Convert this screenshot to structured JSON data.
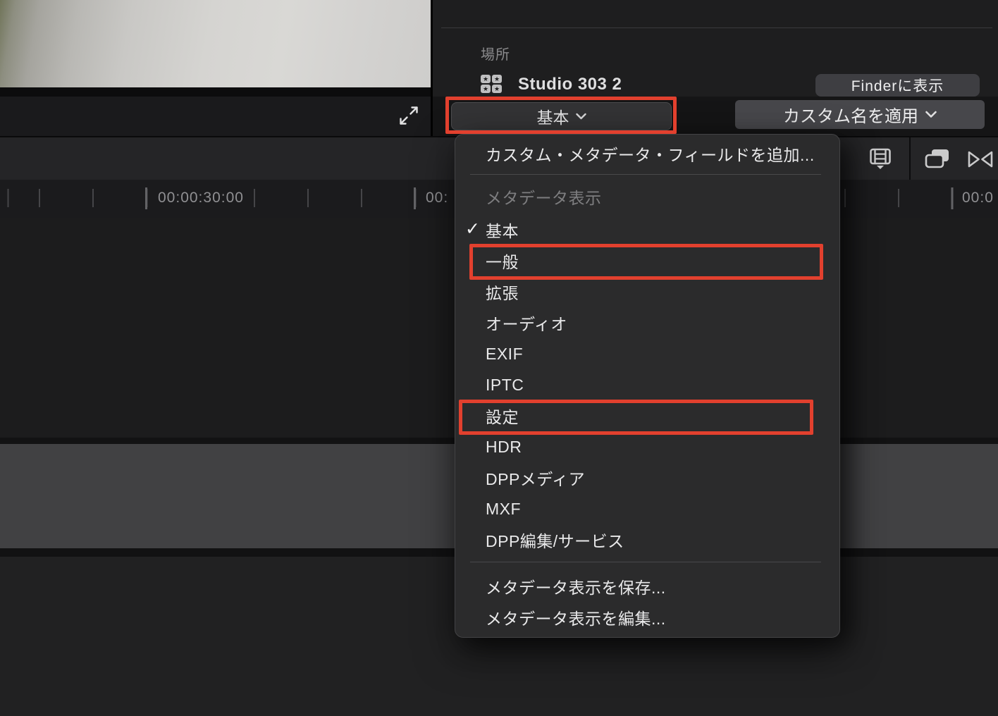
{
  "viewer": {
    "description": "blurred clip preview frame"
  },
  "inspector": {
    "location_label": "場所",
    "location_name": "Studio 303 2",
    "finder_button": "Finderに表示"
  },
  "metadata_bar": {
    "view_button": "基本",
    "apply_custom_name_button": "カスタム名を適用"
  },
  "menu": {
    "add_field": "カスタム・メタデータ・フィールドを追加...",
    "section_header": "メタデータ表示",
    "views": [
      {
        "label": "基本",
        "checked": true
      },
      {
        "label": "一般",
        "hl": "a"
      },
      {
        "label": "拡張"
      },
      {
        "label": "オーディオ"
      },
      {
        "label": "EXIF"
      },
      {
        "label": "IPTC"
      },
      {
        "label": "設定",
        "hl": "b"
      },
      {
        "label": "HDR"
      },
      {
        "label": "DPPメディア"
      },
      {
        "label": "MXF"
      },
      {
        "label": "DPP編集/サービス"
      }
    ],
    "save_view": "メタデータ表示を保存...",
    "edit_view": "メタデータ表示を編集..."
  },
  "ruler": {
    "labels": [
      {
        "text": "00:00:30:00"
      },
      {
        "text": "00:"
      },
      {
        "text": "00:0"
      }
    ]
  },
  "icons": {
    "expand": "expand-diagonal-arrows-icon",
    "collection": "grid-of-starred-squares-icon",
    "filmstrip": "filmstrip-view-icon",
    "stack": "overlapping-clips-icon",
    "bowtie": "bowtie-icon",
    "check": "✓",
    "chevron": "chevron-down-icon"
  },
  "colors": {
    "annotation": "#e2402e",
    "menu_bg": "#2b2b2c",
    "clip_band": "#414143"
  }
}
